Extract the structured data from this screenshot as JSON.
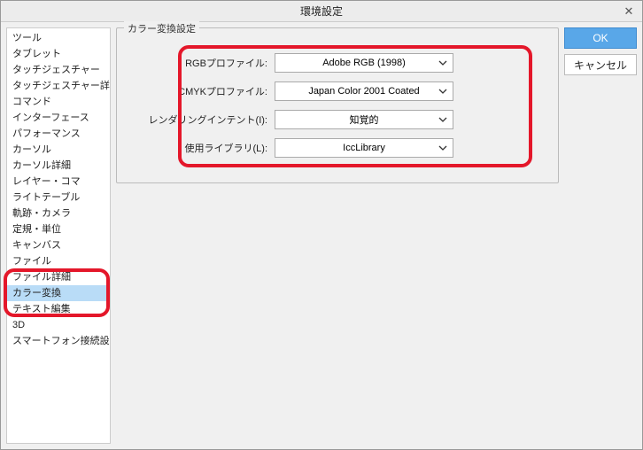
{
  "window": {
    "title": "環境設定",
    "close_tooltip": "閉じる"
  },
  "sidebar": {
    "items": [
      "ツール",
      "タブレット",
      "タッチジェスチャー",
      "タッチジェスチャー詳細",
      "コマンド",
      "インターフェース",
      "パフォーマンス",
      "カーソル",
      "カーソル詳細",
      "レイヤー・コマ",
      "ライトテーブル",
      "軌跡・カメラ",
      "定規・単位",
      "キャンバス",
      "ファイル",
      "ファイル詳細",
      "カラー変換",
      "テキスト編集",
      "3D",
      "スマートフォン接続設定"
    ],
    "selected_index": 16
  },
  "panel": {
    "legend": "カラー変換設定",
    "rows": [
      {
        "label": "RGBプロファイル:",
        "value": "Adobe RGB (1998)"
      },
      {
        "label": "CMYKプロファイル:",
        "value": "Japan Color 2001 Coated"
      },
      {
        "label": "レンダリングインテント(I):",
        "value": "知覚的"
      },
      {
        "label": "使用ライブラリ(L):",
        "value": "IccLibrary"
      }
    ]
  },
  "buttons": {
    "ok": "OK",
    "cancel": "キャンセル"
  }
}
